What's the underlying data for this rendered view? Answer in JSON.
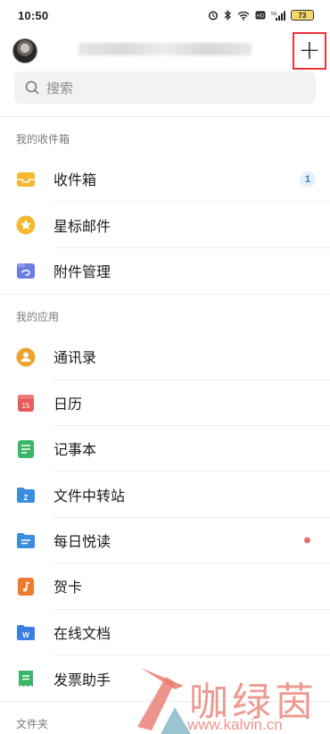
{
  "status_bar": {
    "time": "10:50",
    "battery": "73"
  },
  "header": {
    "add_symbol": "+"
  },
  "search": {
    "placeholder": "搜索"
  },
  "inbox_section": {
    "title": "我的收件箱",
    "items": [
      {
        "label": "收件箱",
        "badge": "1",
        "icon": "inbox-icon",
        "color": "#f5b82e"
      },
      {
        "label": "星标邮件",
        "icon": "star-icon",
        "color": "#f5b82e"
      },
      {
        "label": "附件管理",
        "icon": "attachment-icon",
        "color": "#6b7de0"
      }
    ]
  },
  "apps_section": {
    "title": "我的应用",
    "items": [
      {
        "label": "通讯录",
        "icon": "contacts-icon",
        "color": "#f0a22e"
      },
      {
        "label": "日历",
        "icon": "calendar-icon",
        "icon_text": "15",
        "color": "#e85a5a"
      },
      {
        "label": "记事本",
        "icon": "notepad-icon",
        "color": "#3bb567"
      },
      {
        "label": "文件中转站",
        "icon": "folder-transfer-icon",
        "icon_text": "Z",
        "color": "#3b8de0"
      },
      {
        "label": "每日悦读",
        "icon": "daily-read-icon",
        "color": "#3b8de0"
      },
      {
        "label": "贺卡",
        "icon": "greeting-card-icon",
        "color": "#f07a2e"
      },
      {
        "label": "在线文档",
        "icon": "online-doc-icon",
        "icon_text": "W",
        "color": "#3b7fe0"
      },
      {
        "label": "发票助手",
        "icon": "invoice-icon",
        "color": "#3bb567"
      }
    ]
  },
  "folders_section": {
    "title": "文件夹"
  },
  "watermark": {
    "text": "咖绿茵",
    "url": "www.kalvin.cn"
  }
}
